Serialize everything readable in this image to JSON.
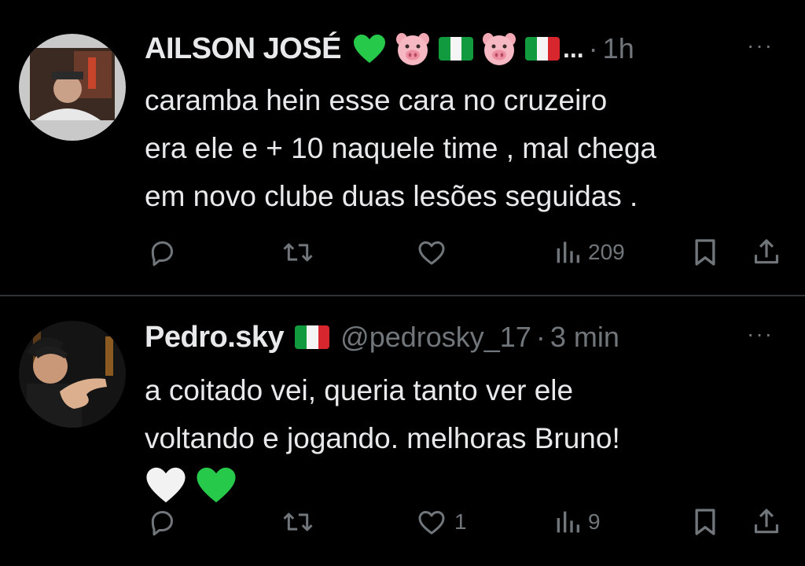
{
  "tweets": [
    {
      "author_name": "AILSON JOSÉ",
      "name_emojis": [
        "green-heart",
        "pig-face",
        "nigeria-flag",
        "pig-face",
        "italy-flag"
      ],
      "truncation": "...",
      "handle": "",
      "dot": "·",
      "time": "1h",
      "more": "···",
      "text_lines": [
        "caramba  hein esse  cara no cruzeiro",
        "era  ele e + 10 naquele time , mal chega",
        "em novo clube  duas lesões seguidas ."
      ],
      "actions": {
        "reply": "",
        "retweet": "",
        "like": "",
        "views": "209"
      }
    },
    {
      "author_name": "Pedro.sky",
      "name_emojis": [
        "italy-flag"
      ],
      "handle": "@pedrosky_17",
      "dot": "·",
      "time": "3 min",
      "more": "···",
      "text_lines": [
        "a coitado vei, queria tanto ver ele",
        "voltando e jogando. melhoras Bruno!"
      ],
      "text_emojis": [
        "white-heart",
        "green-heart"
      ],
      "actions": {
        "reply": "",
        "retweet": "",
        "like": "1",
        "views": "9"
      }
    }
  ],
  "colors": {
    "background": "#000000",
    "text": "#e7e9ea",
    "secondary": "#71767b",
    "divider": "#2f3336"
  }
}
